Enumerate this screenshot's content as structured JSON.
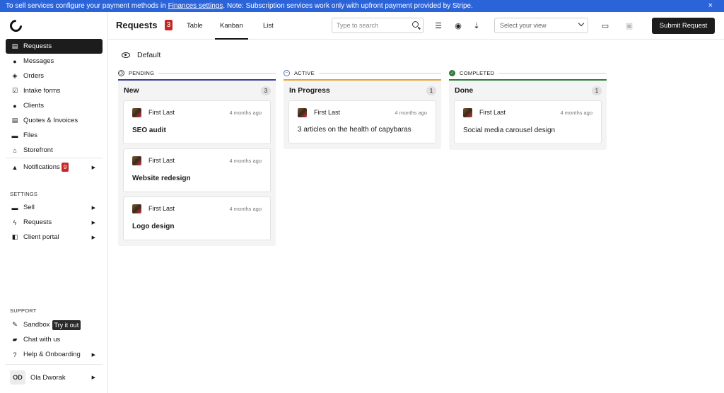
{
  "banner": {
    "text_before": "To sell services configure your payment methods in ",
    "link": "Finances settings",
    "text_after": ". Note: Subscription services work only with upfront payment provided by Stripe.",
    "close": "×"
  },
  "sidebar": {
    "items": [
      {
        "label": "Requests",
        "icon": "inbox-icon",
        "glyph": "▤"
      },
      {
        "label": "Messages",
        "icon": "chat-icon",
        "glyph": "●"
      },
      {
        "label": "Orders",
        "icon": "box-icon",
        "glyph": "◈"
      },
      {
        "label": "Intake forms",
        "icon": "check-form-icon",
        "glyph": "☑"
      },
      {
        "label": "Clients",
        "icon": "user-icon",
        "glyph": "●"
      },
      {
        "label": "Quotes & Invoices",
        "icon": "invoice-icon",
        "glyph": "▤"
      },
      {
        "label": "Files",
        "icon": "folder-icon",
        "glyph": "▬"
      },
      {
        "label": "Storefront",
        "icon": "store-icon",
        "glyph": "⌂"
      }
    ],
    "notifications": {
      "label": "Notifications",
      "count": "9"
    },
    "settings_label": "SETTINGS",
    "settings_items": [
      {
        "label": "Sell"
      },
      {
        "label": "Requests"
      },
      {
        "label": "Client portal"
      }
    ],
    "support_label": "SUPPORT",
    "sandbox": {
      "label": "Sandbox",
      "tag": "Try it out"
    },
    "chat": {
      "label": "Chat with us"
    },
    "help": {
      "label": "Help & Onboarding"
    },
    "user": {
      "initials": "OD",
      "name": "Ola Dworak"
    }
  },
  "header": {
    "title": "Requests",
    "count": "3",
    "tabs": [
      "Table",
      "Kanban",
      "List"
    ],
    "active_tab": "Kanban",
    "search_placeholder": "Type to search",
    "view_placeholder": "Select your view",
    "submit_label": "Submit Request"
  },
  "main": {
    "view_name": "Default",
    "columns": [
      {
        "status": "PENDING",
        "name": "New",
        "count": "3",
        "accent": "#3b3f8f",
        "cards": [
          {
            "author": "First Last",
            "time": "4 months ago",
            "title": "SEO audit"
          },
          {
            "author": "First Last",
            "time": "4 months ago",
            "title": "Website redesign"
          },
          {
            "author": "First Last",
            "time": "4 months ago",
            "title": "Logo design"
          }
        ]
      },
      {
        "status": "ACTIVE",
        "name": "In Progress",
        "count": "1",
        "accent": "#e6a33a",
        "cards": [
          {
            "author": "First Last",
            "time": "4 months ago",
            "title": "3 articles on the health of capybaras"
          }
        ]
      },
      {
        "status": "COMPLETED",
        "name": "Done",
        "count": "1",
        "accent": "#2e7d3a",
        "cards": [
          {
            "author": "First Last",
            "time": "4 months ago",
            "title": "Social media carousel design"
          }
        ]
      }
    ]
  }
}
